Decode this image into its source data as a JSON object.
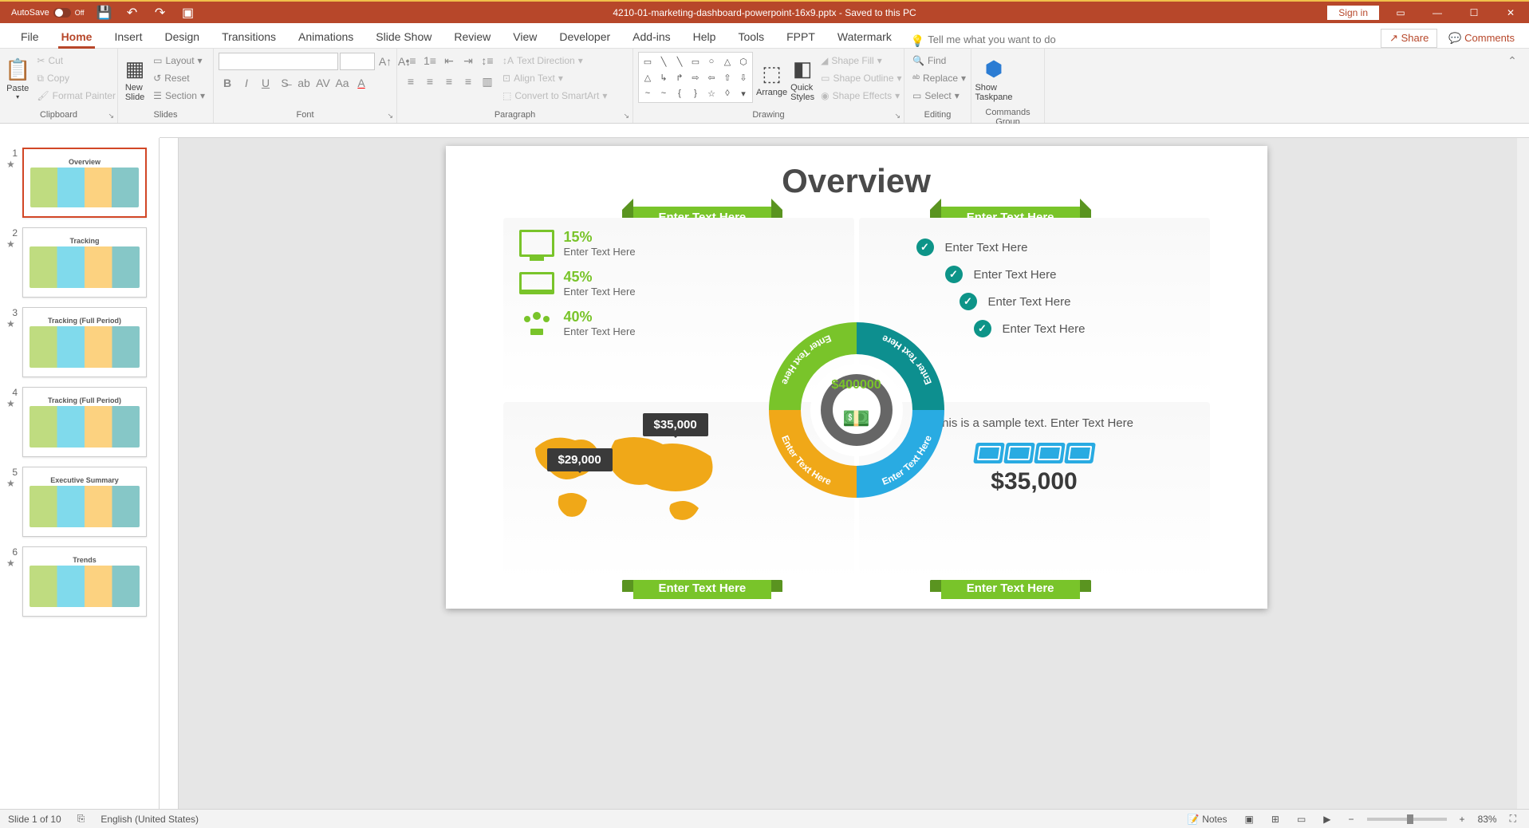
{
  "titlebar": {
    "autosave": "AutoSave",
    "autosave_state": "Off",
    "filename": "4210-01-marketing-dashboard-powerpoint-16x9.pptx",
    "save_status": "Saved to this PC",
    "signin": "Sign in"
  },
  "tabs": [
    "File",
    "Home",
    "Insert",
    "Design",
    "Transitions",
    "Animations",
    "Slide Show",
    "Review",
    "View",
    "Developer",
    "Add-ins",
    "Help",
    "Tools",
    "FPPT",
    "Watermark"
  ],
  "active_tab": "Home",
  "tellme_placeholder": "Tell me what you want to do",
  "share": "Share",
  "comments": "Comments",
  "ribbon": {
    "clipboard": {
      "label": "Clipboard",
      "paste": "Paste",
      "cut": "Cut",
      "copy": "Copy",
      "format_painter": "Format Painter"
    },
    "slides": {
      "label": "Slides",
      "new_slide": "New\nSlide",
      "layout": "Layout",
      "reset": "Reset",
      "section": "Section"
    },
    "font": {
      "label": "Font"
    },
    "paragraph": {
      "label": "Paragraph",
      "text_direction": "Text Direction",
      "align_text": "Align Text",
      "convert_smartart": "Convert to SmartArt"
    },
    "drawing": {
      "label": "Drawing",
      "arrange": "Arrange",
      "quick_styles": "Quick\nStyles",
      "shape_fill": "Shape Fill",
      "shape_outline": "Shape Outline",
      "shape_effects": "Shape Effects"
    },
    "editing": {
      "label": "Editing",
      "find": "Find",
      "replace": "Replace",
      "select": "Select"
    },
    "commands": {
      "label": "Commands Group",
      "show_taskpane": "Show\nTaskpane"
    }
  },
  "thumbnails": [
    {
      "num": "1",
      "title": "Overview"
    },
    {
      "num": "2",
      "title": "Tracking"
    },
    {
      "num": "3",
      "title": "Tracking (Full Period)"
    },
    {
      "num": "4",
      "title": "Tracking (Full Period)"
    },
    {
      "num": "5",
      "title": "Executive Summary"
    },
    {
      "num": "6",
      "title": "Trends"
    }
  ],
  "slide": {
    "title": "Overview",
    "ribbons": {
      "r1": "Enter Text Here",
      "r2": "Enter Text Here",
      "r3": "Enter Text Here",
      "r4": "Enter Text Here"
    },
    "metrics": [
      {
        "pct": "15%",
        "sub": "Enter Text Here"
      },
      {
        "pct": "45%",
        "sub": "Enter Text Here"
      },
      {
        "pct": "40%",
        "sub": "Enter Text Here"
      }
    ],
    "checks": [
      "Enter Text Here",
      "Enter Text Here",
      "Enter Text Here",
      "Enter Text Here"
    ],
    "map": {
      "c1": "$29,000",
      "c2": "$35,000"
    },
    "donut": {
      "center": "$400000",
      "arcs": [
        "Enter Text Here",
        "Enter Text Here",
        "Enter Text Here",
        "Enter Text Here"
      ]
    },
    "q4": {
      "text": "This is a sample text. Enter Text Here",
      "amount": "$35,000"
    }
  },
  "statusbar": {
    "slide_pos": "Slide 1 of 10",
    "lang": "English (United States)",
    "notes": "Notes",
    "zoom": "83%"
  }
}
